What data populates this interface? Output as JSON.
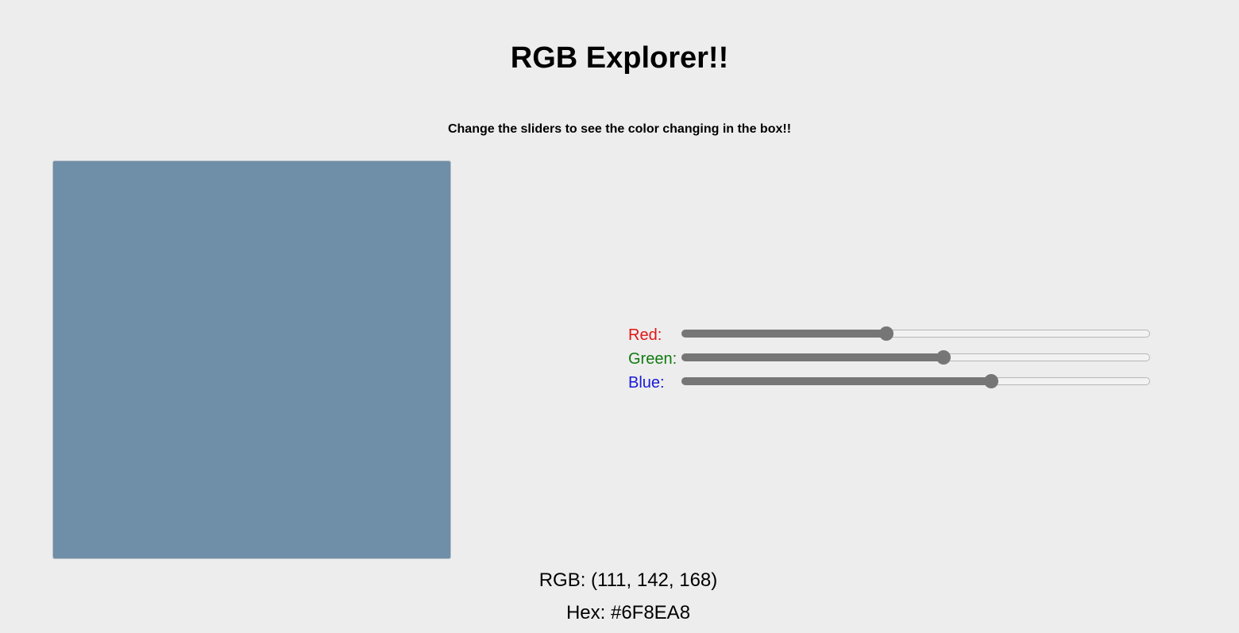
{
  "header": {
    "title": "RGB Explorer!!",
    "subtitle": "Change the sliders to see the color changing in the box!!"
  },
  "preview": {
    "color": "#6F8EA8"
  },
  "sliders": [
    {
      "label": "Red:",
      "value": 111,
      "max": 255,
      "label_color": "#e01515"
    },
    {
      "label": "Green:",
      "value": 142,
      "max": 255,
      "label_color": "#107a10"
    },
    {
      "label": "Blue:",
      "value": 168,
      "max": 255,
      "label_color": "#1a1ad6"
    }
  ],
  "output": {
    "rgb_text": "RGB: (111, 142, 168)",
    "hex_text": "Hex: #6F8EA8"
  }
}
